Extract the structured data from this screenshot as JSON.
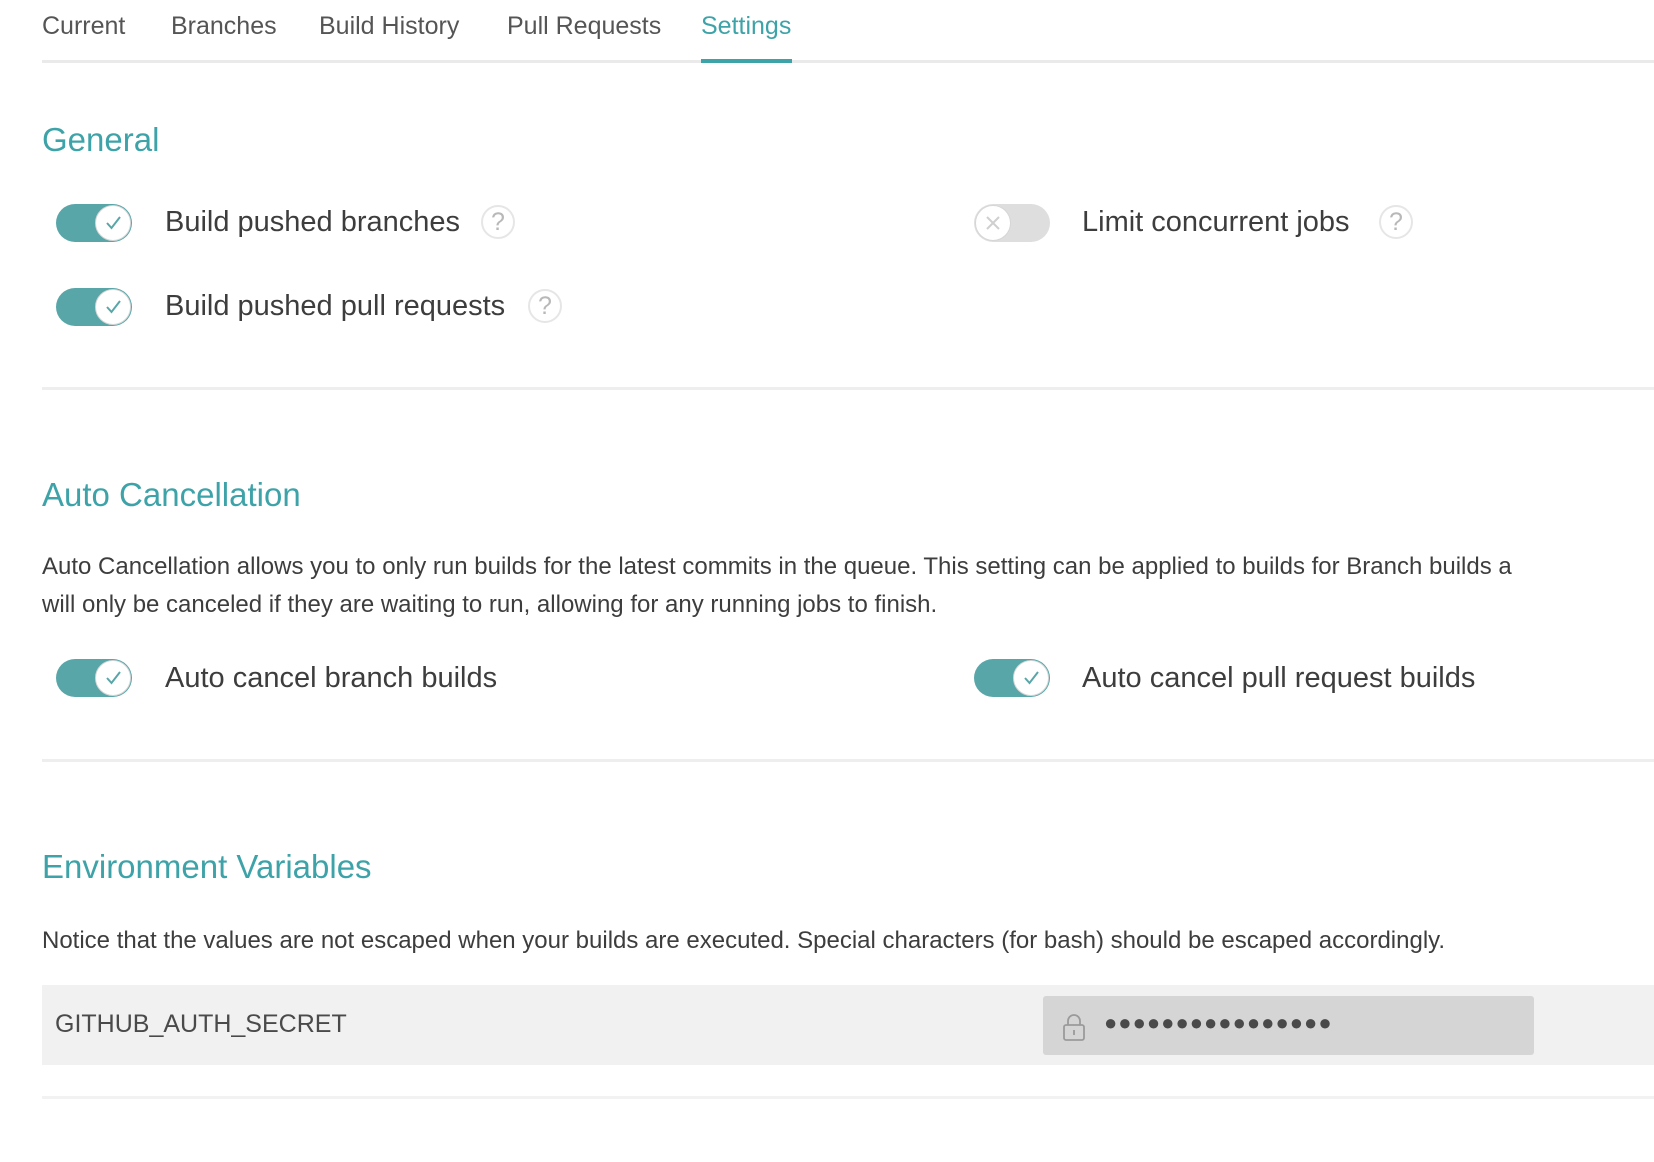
{
  "tabs": [
    {
      "label": "Current",
      "active": false
    },
    {
      "label": "Branches",
      "active": false
    },
    {
      "label": "Build History",
      "active": false
    },
    {
      "label": "Pull Requests",
      "active": false
    },
    {
      "label": "Settings",
      "active": true
    }
  ],
  "accent_color": "#3ea3a8",
  "general": {
    "title": "General",
    "options": [
      {
        "label": "Build pushed branches",
        "enabled": true,
        "help": "?"
      },
      {
        "label": "Limit concurrent jobs",
        "enabled": false,
        "help": "?"
      },
      {
        "label": "Build pushed pull requests",
        "enabled": true,
        "help": "?"
      }
    ]
  },
  "auto_cancellation": {
    "title": "Auto Cancellation",
    "description_line1": "Auto Cancellation allows you to only run builds for the latest commits in the queue. This setting can be applied to builds for Branch builds a",
    "description_line2": "will only be canceled if they are waiting to run, allowing for any running jobs to finish.",
    "options": [
      {
        "label": "Auto cancel branch builds",
        "enabled": true
      },
      {
        "label": "Auto cancel pull request builds",
        "enabled": true
      }
    ]
  },
  "environment_variables": {
    "title": "Environment Variables",
    "notice": "Notice that the values are not escaped when your builds are executed. Special characters (for bash) should be escaped accordingly.",
    "variables": [
      {
        "name": "GITHUB_AUTH_SECRET",
        "value": "●●●●●●●●●●●●●●●●",
        "icon": "lock-icon"
      }
    ]
  }
}
